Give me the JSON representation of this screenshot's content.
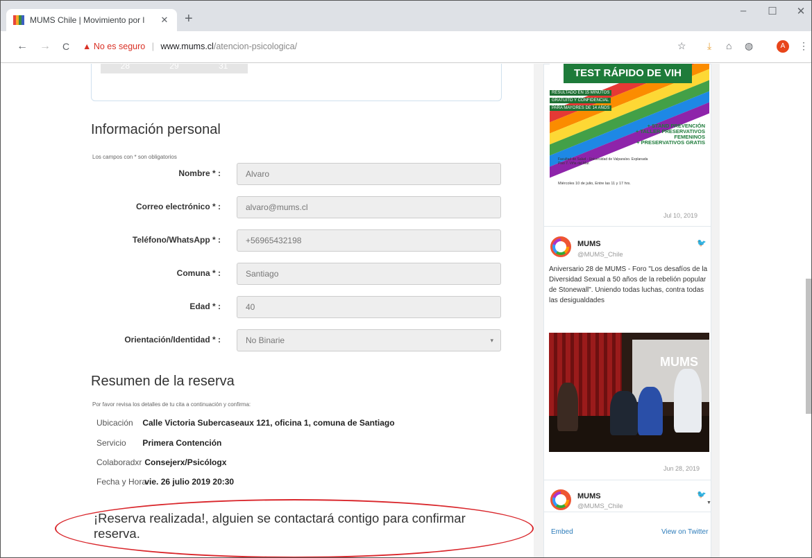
{
  "browser": {
    "tab_title": "MUMS Chile | Movimiento por l",
    "tab_close": "✕",
    "new_tab": "+",
    "window_controls": {
      "minimize": "–",
      "maximize": "☐",
      "close": "✕"
    },
    "nav": {
      "back": "←",
      "forward": "→",
      "reload": "C"
    },
    "insecure_icon": "▲",
    "insecure_label": "No es seguro",
    "url_separator": "|",
    "url_domain": "www.mums.cl",
    "url_path": "/atencion-psicologica/",
    "star": "☆",
    "ext_icons": [
      "⤓",
      "⌂",
      "◍"
    ],
    "profile_initial": "A",
    "menu": "⋮"
  },
  "calendar": {
    "days": [
      "28",
      "29",
      "31"
    ]
  },
  "personal": {
    "heading": "Información personal",
    "required_note": "Los campos con * son obligatorios",
    "fields": [
      {
        "label": "Nombre * :",
        "value": "Alvaro"
      },
      {
        "label": "Correo electrónico * :",
        "value": "alvaro@mums.cl"
      },
      {
        "label": "Teléfono/WhatsApp * :",
        "value": "+56965432198"
      },
      {
        "label": "Comuna * :",
        "value": "Santiago"
      },
      {
        "label": "Edad * :",
        "value": "40"
      },
      {
        "label": "Orientación/Identidad * :",
        "value": "No Binarie",
        "caret": "▾"
      }
    ]
  },
  "summary": {
    "heading": "Resumen de la reserva",
    "note": "Por favor revisa los detalles de tu cita a continuación y confirma:",
    "rows": [
      {
        "key": "Ubicación",
        "value": "Calle Victoria Subercaseaux 121, oficina 1, comuna de Santiago"
      },
      {
        "key": "Servicio",
        "value": "Primera Contención"
      },
      {
        "key": "Colaboradxr",
        "value": "Consejerx/Psicólogx"
      },
      {
        "key": "Fecha y Hora",
        "value": "vie. 26 julio 2019 20:30"
      }
    ]
  },
  "confirmation": "¡Reserva realizada!, alguien se contactará contigo para confirmar reserva.",
  "twitter": {
    "poster": {
      "title": "TEST RÁPIDO DE VIH",
      "lines": [
        "RESULTADO EN 15 MINUTOS",
        "GRATUITO Y CONFIDENCIAL",
        "PARA MAYORES DE 14 AÑOS"
      ],
      "bullets": [
        "+ STAND PREVENCIÓN",
        "+ TALLER PRESERVATIVOS",
        "FEMENINOS",
        "+ PRESERVATIVOS GRATIS"
      ],
      "info": "Facultad de Salud - Universidad de Valparaíso. Explanada Piso 7. Viña del Mar.",
      "date": "Miércoles 10 de julio, Entre las 11 y 17 hrs."
    },
    "tweet1_date": "Jul 10, 2019",
    "tweet2": {
      "name": "MUMS",
      "handle": "@MUMS_Chile",
      "text": "Aniversario 28 de MUMS - Foro \"Los desafíos de la Diversidad Sexual a 50 años de la rebelión popular de Stonewall\". Uniendo todas luchas, contra todas las desigualdades",
      "photo_text": "MUMS",
      "date": "Jun 28, 2019"
    },
    "tweet3": {
      "name": "MUMS",
      "handle": "@MUMS_Chile"
    },
    "bird": "🐦",
    "embed": "Embed",
    "view_on_twitter": "View on Twitter",
    "scroll_arrow": "▼"
  },
  "colors": {
    "accent_red": "#d9262b",
    "poster_green": "#1e7b3a",
    "twitter_blue": "#2b7bb9"
  }
}
